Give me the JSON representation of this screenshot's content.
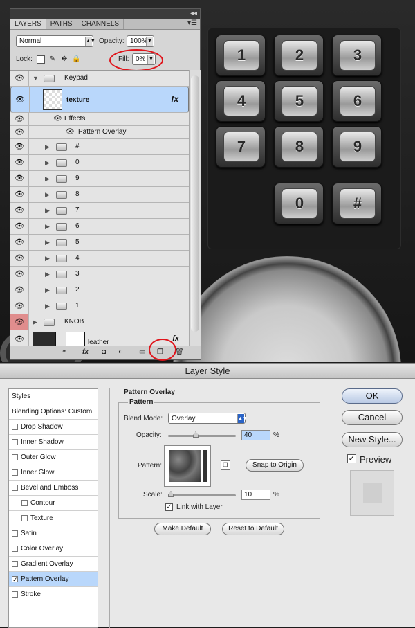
{
  "layers_panel": {
    "tabs": [
      "LAYERS",
      "PATHS",
      "CHANNELS"
    ],
    "blend_mode": "Normal",
    "opacity_label": "Opacity:",
    "opacity_value": "100%",
    "lock_label": "Lock:",
    "fill_label": "Fill:",
    "fill_value": "0%",
    "layers": [
      {
        "name": "Keypad",
        "type": "group-open"
      },
      {
        "name": "texture",
        "type": "layer",
        "fx": "fx"
      },
      {
        "name": "Effects",
        "type": "effects"
      },
      {
        "name": "Pattern Overlay",
        "type": "effect"
      },
      {
        "name": "#",
        "type": "group"
      },
      {
        "name": "0",
        "type": "group"
      },
      {
        "name": "9",
        "type": "group"
      },
      {
        "name": "8",
        "type": "group"
      },
      {
        "name": "7",
        "type": "group"
      },
      {
        "name": "6",
        "type": "group"
      },
      {
        "name": "5",
        "type": "group"
      },
      {
        "name": "4",
        "type": "group"
      },
      {
        "name": "3",
        "type": "group"
      },
      {
        "name": "2",
        "type": "group"
      },
      {
        "name": "1",
        "type": "group"
      },
      {
        "name": "KNOB",
        "type": "group-top"
      },
      {
        "name": "leather",
        "type": "layer-bottom",
        "fx": "fx"
      }
    ]
  },
  "keypad": {
    "keys": [
      "1",
      "2",
      "3",
      "4",
      "5",
      "6",
      "7",
      "8",
      "9",
      "0",
      "#"
    ]
  },
  "dialog": {
    "title": "Layer Style",
    "styles_header": "Styles",
    "blending_options": "Blending Options: Custom",
    "style_items": [
      {
        "label": "Drop Shadow",
        "checked": false
      },
      {
        "label": "Inner Shadow",
        "checked": false
      },
      {
        "label": "Outer Glow",
        "checked": false
      },
      {
        "label": "Inner Glow",
        "checked": false
      },
      {
        "label": "Bevel and Emboss",
        "checked": false
      },
      {
        "label": "Contour",
        "checked": false
      },
      {
        "label": "Texture",
        "checked": false
      },
      {
        "label": "Satin",
        "checked": false
      },
      {
        "label": "Color Overlay",
        "checked": false
      },
      {
        "label": "Gradient Overlay",
        "checked": false
      },
      {
        "label": "Pattern Overlay",
        "checked": true
      },
      {
        "label": "Stroke",
        "checked": false
      }
    ],
    "section_title": "Pattern Overlay",
    "group_title": "Pattern",
    "blend_mode_label": "Blend Mode:",
    "blend_mode_value": "Overlay",
    "opacity_label": "Opacity:",
    "opacity_value": "40",
    "percent": "%",
    "pattern_label": "Pattern:",
    "snap_button": "Snap to Origin",
    "scale_label": "Scale:",
    "scale_value": "10",
    "link_label": "Link with Layer",
    "make_default": "Make Default",
    "reset_default": "Reset to Default",
    "ok": "OK",
    "cancel": "Cancel",
    "new_style": "New Style...",
    "preview": "Preview"
  },
  "colors": {
    "selection": "#b9d7fb",
    "highlight_ring": "#e0141b",
    "knob_eye": "#e08d8d"
  }
}
